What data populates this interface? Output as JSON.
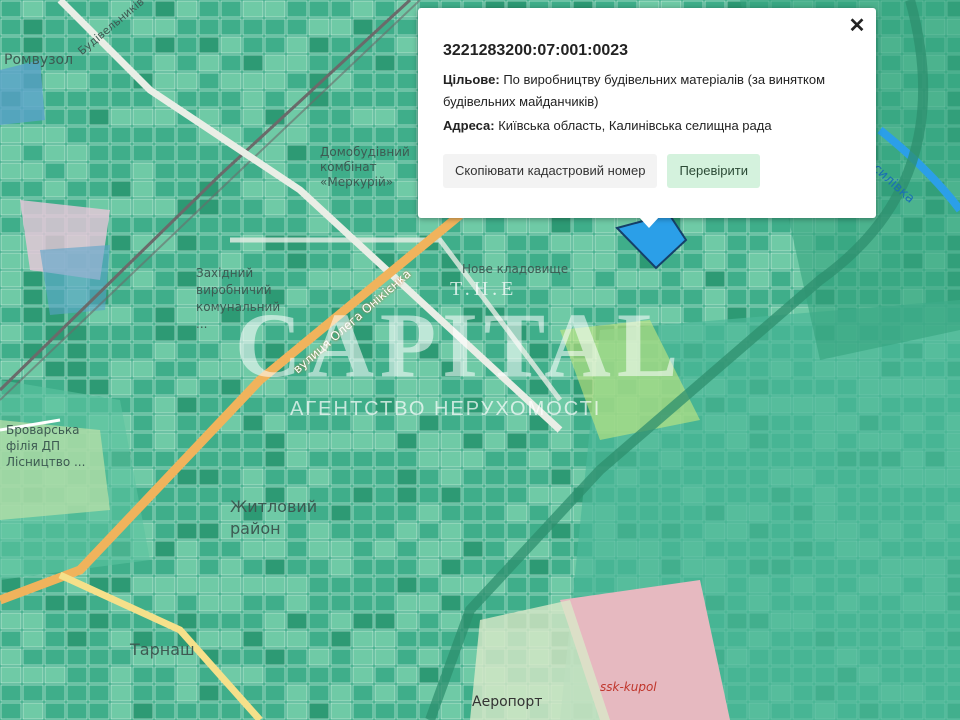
{
  "popup": {
    "cadastral_number": "3221283200:07:001:0023",
    "purpose_label": "Цільове:",
    "purpose_value": "По виробництву будівельних матеріалів (за винятком будівельних майданчиків)",
    "address_label": "Адреса:",
    "address_value": "Київська область, Калинівська селищна рада",
    "copy_button": "Скопіювати кадастровий номер",
    "check_button": "Перевірити",
    "close_icon": "close-icon"
  },
  "map": {
    "labels": [
      "Будівельників",
      "Ромвузол",
      "Домобудівний комбінат «Меркурій»",
      "Нове кладовище",
      "Західний виробничий комунальний ...",
      "вулиця Олега Онікієнка",
      "Броварська філія ДП Лісництво ...",
      "Житловий район",
      "Тарнаш",
      "Аеропорт",
      "ssk-kupol",
      "Василівка"
    ],
    "colors": {
      "parcel": "#3fae8a",
      "parcel_light": "#6fcaa6",
      "selected_parcel": "#2b9fe8",
      "road_major": "#f0b35c",
      "road_minor": "#f5e08a",
      "railway": "#6a6a6a",
      "industrial": "#e6b9c0"
    }
  },
  "watermark": {
    "top": "T.H.E",
    "brand": "CAPITAL",
    "subtitle": "АГЕНТСТВО НЕРУХОМОСТІ"
  }
}
